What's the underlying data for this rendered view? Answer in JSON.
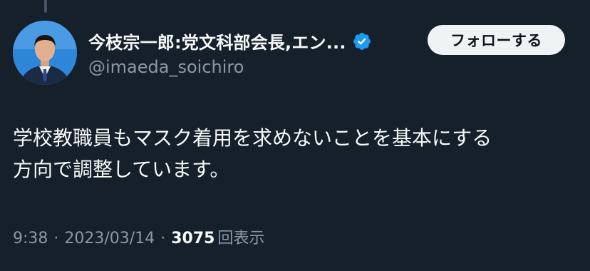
{
  "user": {
    "display_name": "今枝宗一郎:党文科部会長,エン...",
    "handle": "@imaeda_soichiro",
    "verified_icon": "verified-badge-icon",
    "avatar_icon": "profile-avatar"
  },
  "follow_button": {
    "label": "フォローする"
  },
  "tweet": {
    "lines": [
      "学校教職員もマスク着用を求めないことを基本にする",
      "方向で調整しています。"
    ]
  },
  "meta": {
    "time": "9:38",
    "separator": "·",
    "date": "2023/03/14",
    "views_count": "3075",
    "views_label": "回表示"
  },
  "colors": {
    "background": "#15202b",
    "text": "#f7f9f9",
    "secondary": "#8b98a5",
    "verified": "#1d9bf0",
    "button_bg": "#eff3f4"
  }
}
